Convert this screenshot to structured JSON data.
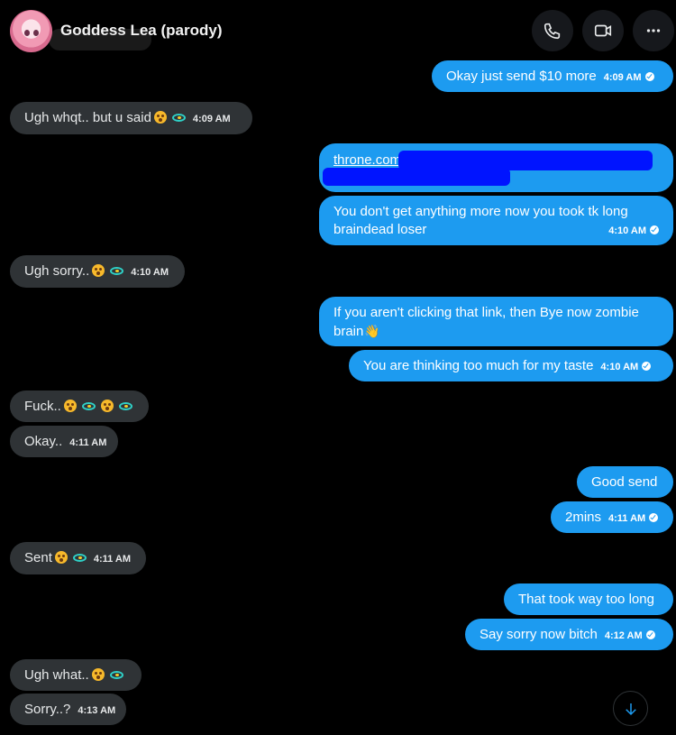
{
  "header": {
    "contact_name": "Goddess Lea (parody)"
  },
  "icons": {
    "call": "phone-icon",
    "video": "video-icon",
    "more": "more-horizontal-icon",
    "scroll": "arrow-down-icon",
    "read_receipt": "check-circle-icon"
  },
  "colors": {
    "outgoing": "#1d9bf0",
    "incoming": "#2f3336",
    "background": "#000000"
  },
  "messages": {
    "m1": {
      "text": "Okay just send $10 more",
      "time": "4:09 AM"
    },
    "m2": {
      "text": "Ugh whqt.. but u said",
      "time": "4:09 AM"
    },
    "m3": {
      "link": "throne.com/"
    },
    "m4": {
      "line1": "You don't get anything more now you took tk long",
      "line2": "braindead loser",
      "time": "4:10 AM"
    },
    "m5": {
      "text": "Ugh sorry..",
      "time": "4:10 AM"
    },
    "m6": {
      "line1": "If you aren't clicking that link, then Bye now zombie",
      "line2": "brain"
    },
    "m7": {
      "text": "You are thinking too much for my taste",
      "time": "4:10 AM"
    },
    "m8": {
      "text": "Fuck.."
    },
    "m9": {
      "text": "Okay..",
      "time": "4:11 AM"
    },
    "m10": {
      "text": "Good send"
    },
    "m11": {
      "text": "2mins",
      "time": "4:11 AM"
    },
    "m12": {
      "text": "Sent",
      "time": "4:11 AM"
    },
    "m13": {
      "text": "That took way too long"
    },
    "m14": {
      "text": "Say sorry now bitch",
      "time": "4:12 AM"
    },
    "m15": {
      "text": "Ugh what.."
    },
    "m16": {
      "text": "Sorry..?",
      "time": "4:13 AM"
    }
  }
}
